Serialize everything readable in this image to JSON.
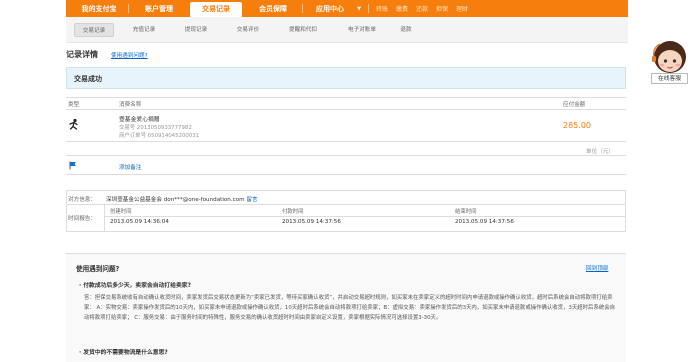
{
  "nav": {
    "tabs": [
      {
        "label": "我的支付宝"
      },
      {
        "label": "账户管理"
      },
      {
        "label": "交易记录"
      },
      {
        "label": "会员保障"
      },
      {
        "label": "应用中心"
      }
    ],
    "app_arrow": "▼",
    "quick": [
      "转账",
      "缴费",
      "还款",
      "担保",
      "理财"
    ]
  },
  "subnav": [
    "交易记录",
    "充值记录",
    "提现记录",
    "交易评价",
    "提醒和代扣",
    "电子对账单",
    "退款"
  ],
  "page": {
    "title": "记录详情",
    "help_link": "使用遇到问题?",
    "status": "交易成功"
  },
  "table": {
    "headers": {
      "type": "类型",
      "name": "消费名称",
      "amount": "应付金额"
    },
    "order": {
      "name": "壹基金爱心捐赠",
      "trade_no": "交易号 2013050933777982",
      "merchant_no": "商户订单号 050914045200031",
      "amount": "285.00"
    },
    "unit": "单位（元）",
    "add_note": "添加备注"
  },
  "info": {
    "party_label": "对方信息：",
    "party_name": "深圳壹基金公益基金会",
    "party_email": "don***@one-foundation.com",
    "party_msg": "留言",
    "time_label": "时间报告：",
    "time_headers": [
      "创建时间",
      "付款时间",
      "结束时间"
    ],
    "time_values": [
      "2013.05.09 14:36:04",
      "2013.05.09 14:37:56",
      "2013.05.09 14:37:56"
    ]
  },
  "help": {
    "title": "使用遇到问题?",
    "back_top": "回到顶部",
    "q1": "付款成功后多少天，卖家会自动打给卖家?",
    "a1": "答：担保交易系统收有自动确认收货时间，卖家发货后交易状态更新为“卖家已发货，等待买家确认收货”，并启动交易超时规则，如买家未在卖家定义的超时时间内申请退款或操作确认收货，超时后系统会自动将款项打给卖家：  A：实物交易：卖家操作发货后的10天内，如买家未申请退款或操作确认收货，10天超时后系统会自动将款项打给卖家；B：虚拟交易：卖家操作发货后的3天内，如买家未申请退款或操作确认收货，3天超时后系统会自动将款项打给卖家；  C：服务交易：由于服务时间的特殊性，服务交易的确认收货超时时间由卖家自定义设置，卖家根据实际情况可选择设置3-30天。",
    "q2": "发货中的不需要物流是什么意思?"
  },
  "side": {
    "customer_service": "在线客服"
  },
  "colors": {
    "brand_orange": "#f57e0c",
    "link_blue": "#0066cc",
    "status_bg": "#e8f4fb"
  }
}
